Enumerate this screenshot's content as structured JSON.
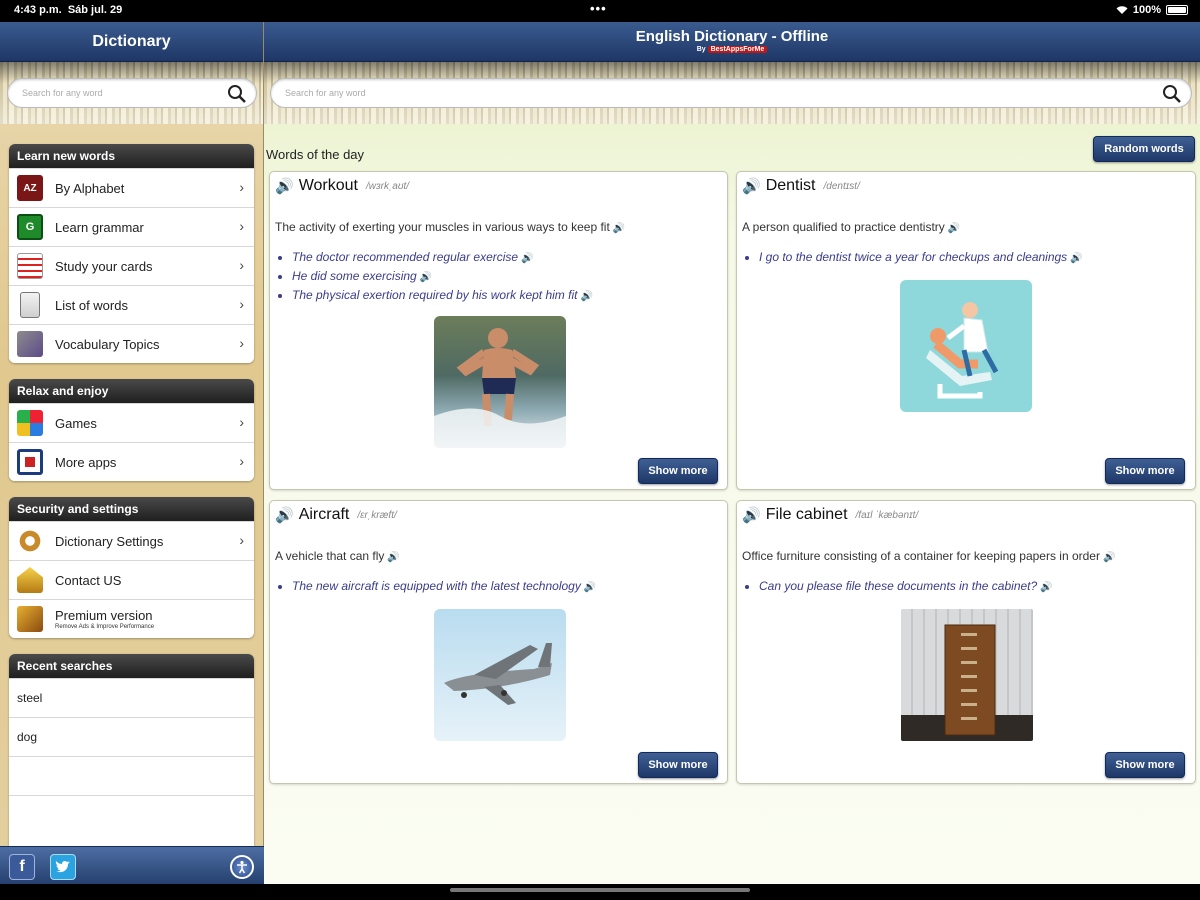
{
  "status": {
    "time": "4:43 p.m.",
    "date": "Sáb jul. 29",
    "dots": "•••",
    "battery": "100%"
  },
  "sidebar": {
    "title": "Dictionary",
    "search_placeholder": "Search for any word",
    "groups": [
      {
        "header": "Learn new words",
        "items": [
          {
            "label": "By Alphabet"
          },
          {
            "label": "Learn grammar"
          },
          {
            "label": "Study your cards"
          },
          {
            "label": "List of words"
          },
          {
            "label": "Vocabulary Topics"
          }
        ]
      },
      {
        "header": "Relax and enjoy",
        "items": [
          {
            "label": "Games"
          },
          {
            "label": "More apps"
          }
        ]
      },
      {
        "header": "Security and settings",
        "items": [
          {
            "label": "Dictionary Settings"
          },
          {
            "label": "Contact US"
          },
          {
            "label": "Premium version",
            "sub": "Remove Ads & Improve Performance"
          }
        ]
      }
    ],
    "recent_header": "Recent searches",
    "recent": [
      "steel",
      "dog"
    ],
    "icon_az": "AZ",
    "icon_g": "G",
    "facebook": "f"
  },
  "main": {
    "title": "English Dictionary - Offline",
    "byline_prefix": "By",
    "byline_brand": "BestAppsForMe",
    "search_placeholder": "Search for any word",
    "words_of_day": "Words of the day",
    "random_button": "Random words",
    "show_more": "Show more",
    "cards": [
      {
        "word": "Workout",
        "phonetic": "/wɜrkˌaʊt/",
        "definition": "The activity of exerting your muscles in various ways to keep fit",
        "examples": [
          "The doctor recommended regular exercise",
          "He did some exercising",
          "The physical exertion required by his work kept him fit"
        ]
      },
      {
        "word": "Dentist",
        "phonetic": "/dentɪst/",
        "definition": "A person qualified to practice dentistry",
        "examples": [
          "I go to the dentist twice a year for checkups and cleanings"
        ]
      },
      {
        "word": "Aircraft",
        "phonetic": "/ɛrˌkræft/",
        "definition": "A vehicle that can fly",
        "examples": [
          "The new aircraft is equipped with the latest technology"
        ]
      },
      {
        "word": "File cabinet",
        "phonetic": "/faɪl ˈkæbənɪt/",
        "definition": "Office furniture consisting of a container for keeping papers in order",
        "examples": [
          "Can you please file these documents in the cabinet?"
        ]
      }
    ]
  }
}
